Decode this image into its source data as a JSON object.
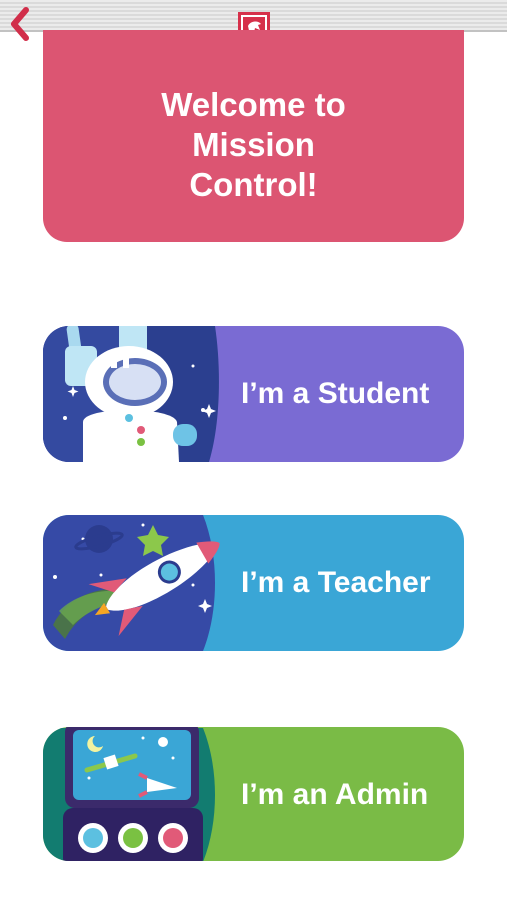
{
  "header": {
    "back_icon": "chevron-left-icon",
    "logo_icon": "shield-logo-icon"
  },
  "welcome": {
    "line1": "Welcome to",
    "line2": "Mission Control!"
  },
  "roles": [
    {
      "label": "I’m a Student",
      "color": "#7a6bd3",
      "art": "astronaut-illustration"
    },
    {
      "label": "I’m a Teacher",
      "color": "#3aa6d6",
      "art": "rocket-illustration"
    },
    {
      "label": "I’m an Admin",
      "color": "#7abb46",
      "art": "control-monitor-illustration"
    }
  ],
  "colors": {
    "welcome_bg": "#dc5572",
    "accent_red": "#d6304a"
  }
}
